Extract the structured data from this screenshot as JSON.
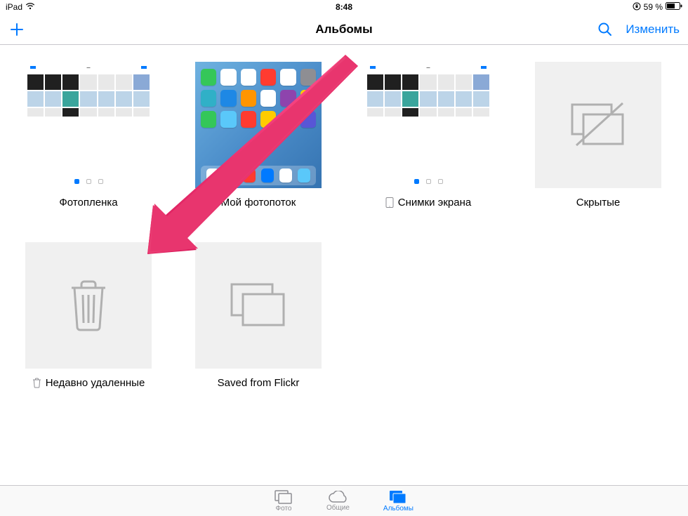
{
  "status": {
    "device": "iPad",
    "wifi_icon": "wifi",
    "time": "8:48",
    "orientation_lock_icon": "lock-rotation",
    "battery_text": "59 %"
  },
  "nav": {
    "title": "Альбомы",
    "add_icon": "plus",
    "search_icon": "search",
    "edit_label": "Изменить"
  },
  "albums": [
    {
      "label": "Фотопленка",
      "thumb": "photos-mock",
      "pre_icon": null
    },
    {
      "label": "Мой фотопоток",
      "thumb": "home-mock",
      "pre_icon": null
    },
    {
      "label": "Снимки экрана",
      "thumb": "photos-mock",
      "pre_icon": "ipad"
    },
    {
      "label": "Скрытые",
      "thumb": "hidden-icon",
      "pre_icon": null
    },
    {
      "label": "Недавно удаленные",
      "thumb": "trash-icon",
      "pre_icon": "trash"
    },
    {
      "label": "Saved from Flickr",
      "thumb": "stack-icon",
      "pre_icon": null
    }
  ],
  "tabs": [
    {
      "label": "Фото",
      "icon": "photos",
      "active": false
    },
    {
      "label": "Общие",
      "icon": "cloud",
      "active": false
    },
    {
      "label": "Альбомы",
      "icon": "albums",
      "active": true
    }
  ],
  "colors": {
    "tint": "#007aff",
    "inactive": "#8e8e93",
    "arrow": "#e8356e"
  }
}
